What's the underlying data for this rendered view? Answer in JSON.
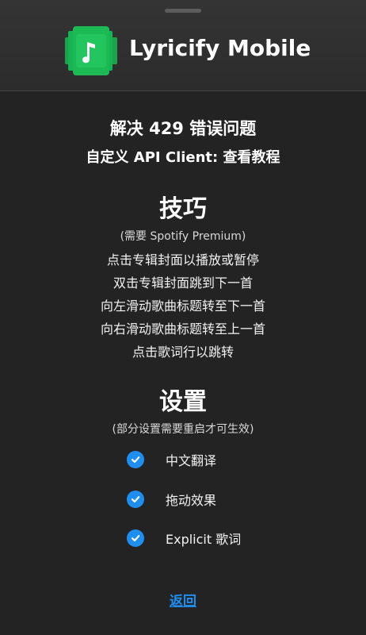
{
  "app": {
    "title": "Lyricify Mobile",
    "logo_icon": "lyricify-music-note-logo",
    "accent_color": "#1db954"
  },
  "header_text": {
    "fix_429": "解决 429 错误问题",
    "client_prefix": "自定义 API Client: ",
    "client_link": "查看教程"
  },
  "tips": {
    "title": "技巧",
    "note": "(需要 Spotify Premium)",
    "items": [
      "点击专辑封面以播放或暂停",
      "双击专辑封面跳到下一首",
      "向左滑动歌曲标题转至下一首",
      "向右滑动歌曲标题转至上一首",
      "点击歌词行以跳转"
    ]
  },
  "settings": {
    "title": "设置",
    "note": "(部分设置需要重启才可生效)",
    "check_color": "#1f8ef1",
    "items": [
      {
        "label": "中文翻译",
        "checked": true,
        "icon": "check-circle-icon"
      },
      {
        "label": "拖动效果",
        "checked": true,
        "icon": "check-circle-icon"
      },
      {
        "label": "Explicit 歌词",
        "checked": true,
        "icon": "check-circle-icon"
      }
    ]
  },
  "footer": {
    "back_label": "返回"
  }
}
